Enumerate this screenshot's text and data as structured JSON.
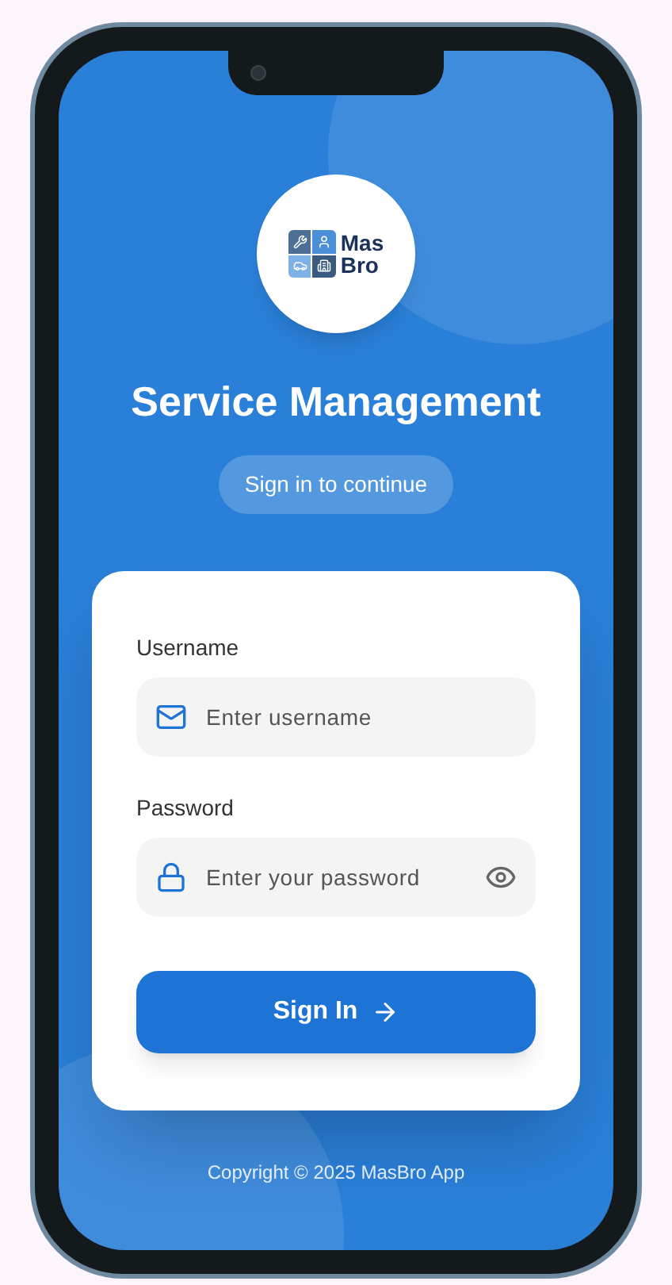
{
  "logo": {
    "line_1": "Mas",
    "line_2": "Bro"
  },
  "title": "Service Management",
  "subtitle": "Sign in to continue",
  "form": {
    "fields": [
      {
        "label": "Username",
        "placeholder": "Enter username",
        "kind": "text"
      },
      {
        "label": "Password",
        "placeholder": "Enter your password",
        "kind": "password"
      }
    ],
    "submit": "Sign In"
  },
  "footer": "Copyright © 2025 MasBro App"
}
